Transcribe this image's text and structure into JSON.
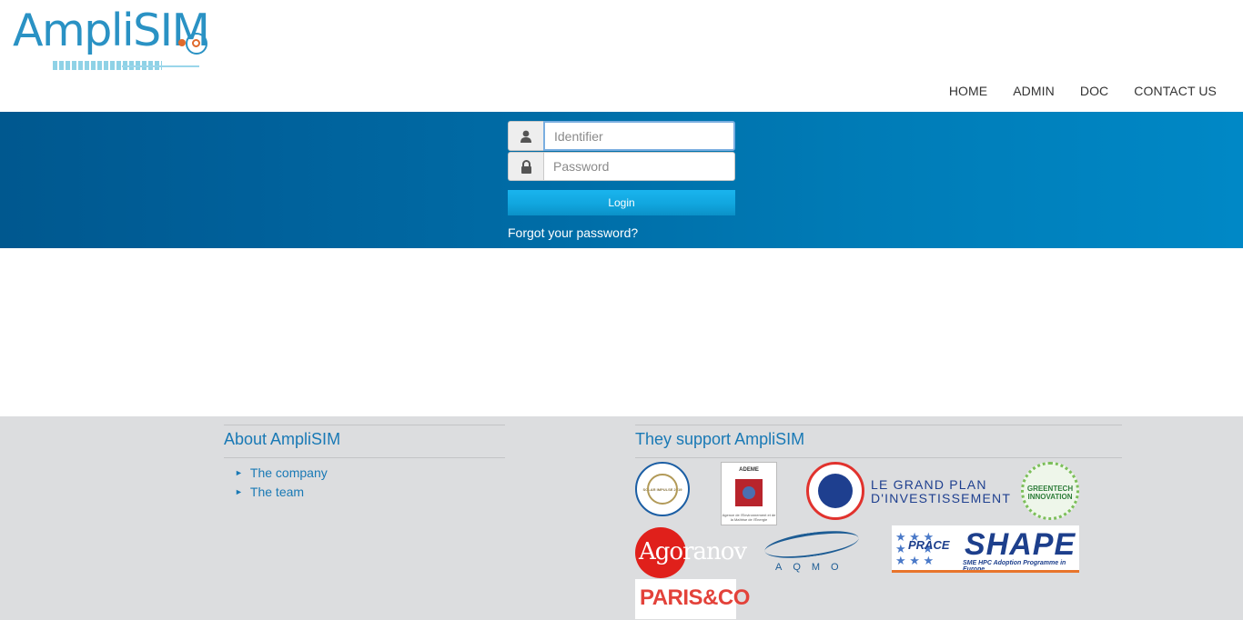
{
  "header": {
    "logo_text": "AmpliSIM",
    "nav": {
      "home": "HOME",
      "admin": "ADMIN",
      "doc": "DOC",
      "contact": "CONTACT US"
    }
  },
  "login": {
    "identifier_placeholder": "Identifier",
    "password_placeholder": "Password",
    "login_label": "Login",
    "forgot_label": "Forgot your password?"
  },
  "footer": {
    "about": {
      "title": "About AmpliSIM",
      "links": [
        "The company",
        "The team"
      ]
    },
    "support": {
      "title": "They support AmpliSIM",
      "partners": {
        "solar_impulse": "SOLAR IMPULSE 2019",
        "ademe": "ADEME",
        "ademe_sub": "Agence de l'Environnement et de la Maîtrise de l'Énergie",
        "investir": "LE GRAND PLAN D'INVESTISSEMENT",
        "greentech": "GREENTECH INNOVATION",
        "agoranov": "Agoranov",
        "aqmo": "AQMO",
        "prace": "PRACE",
        "shape": "SHAPE",
        "shape_sub": "SME HPC Adoption Programme in Europe",
        "paris_co": "PARIS&CO"
      }
    }
  },
  "colors": {
    "brand_blue": "#2a92c4",
    "band_dark": "#00588f",
    "band_light": "#0088c6",
    "link_blue": "#1979b5",
    "footer_bg": "#dcdddf"
  },
  "icons": {
    "identifier": "user-icon",
    "password": "lock-icon",
    "list_bullet": "triangle-right-icon"
  }
}
